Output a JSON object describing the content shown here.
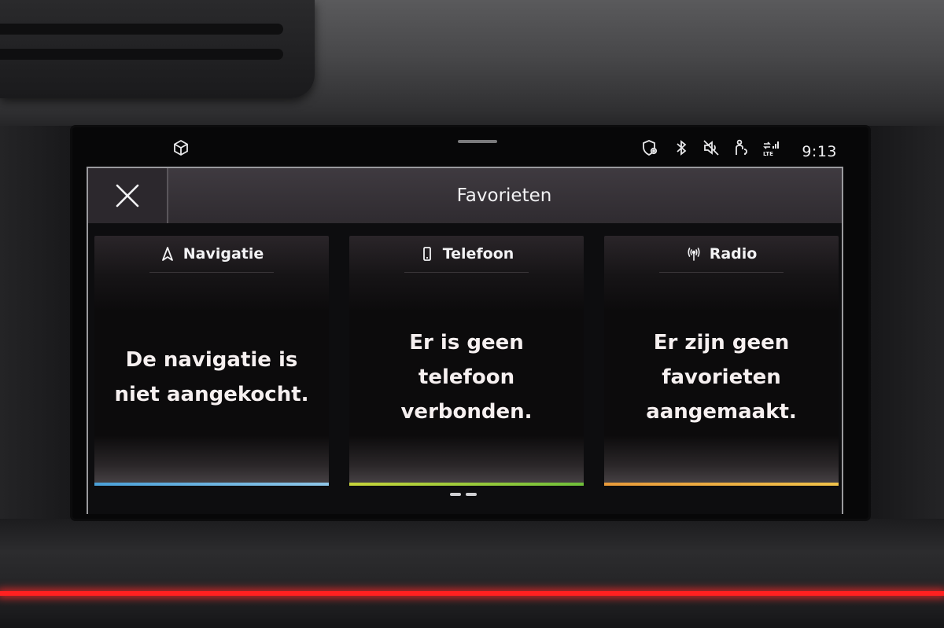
{
  "status_bar": {
    "time": "9:13",
    "icons": [
      "cube-icon",
      "shield-location-icon",
      "bluetooth-icon",
      "speaker-muted-icon",
      "passenger-airbag-icon",
      "lte-signal-icon"
    ]
  },
  "dialog": {
    "title": "Favorieten",
    "close_icon": "close-icon"
  },
  "cards": [
    {
      "title": "Navigatie",
      "icon": "navigation-arrow-icon",
      "message": "De navigatie is niet aangekocht.",
      "accent": "#5aa9d6"
    },
    {
      "title": "Telefoon",
      "icon": "phone-icon",
      "message": "Er is geen telefoon verbonden.",
      "accent": "#9bc43a"
    },
    {
      "title": "Radio",
      "icon": "radio-antenna-icon",
      "message": "Er zijn geen favorieten aangemaakt.",
      "accent": "#e6a33a"
    }
  ],
  "colors": {
    "ambient_light": "#ff2020",
    "header_bg": "#3a353b"
  }
}
